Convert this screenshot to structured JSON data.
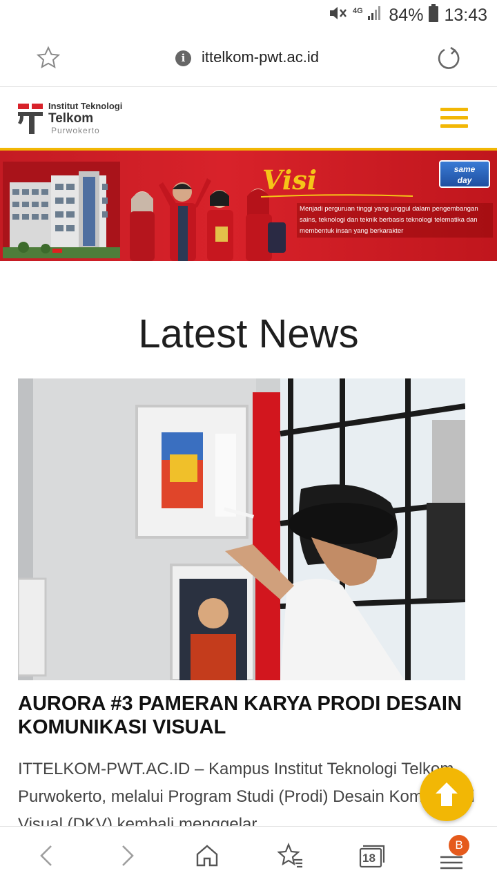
{
  "status_bar": {
    "battery": "84%",
    "time": "13:43",
    "network": "4G"
  },
  "address_bar": {
    "url": "ittelkom-pwt.ac.id"
  },
  "site": {
    "logo_line1": "Institut Teknologi",
    "logo_line2": "Telkom",
    "logo_line3": "Purwokerto"
  },
  "banner": {
    "title": "Visi",
    "text": "Menjadi perguruan tinggi yang unggul dalam pengembangan sains, teknologi dan teknik berbasis teknologi telematika dan membentuk insan yang berkarakter",
    "badge_line1": "same",
    "badge_line2": "day"
  },
  "main": {
    "section_title": "Latest News",
    "headline": "AURORA #3 PAMERAN KARYA PRODI DESAIN KOMUNIKASI VISUAL",
    "excerpt": "ITTELKOM-PWT.AC.ID – Kampus Institut Teknologi Telkom Purwokerto, melalui Program Studi (Prodi) Desain Komunikasi Visual (DKV) kembali menggelar"
  },
  "bottom_nav": {
    "tab_count": "18",
    "menu_badge": "B"
  },
  "colors": {
    "brand_red": "#d8222a",
    "brand_yellow": "#f2b705",
    "badge_orange": "#e55a1c"
  }
}
